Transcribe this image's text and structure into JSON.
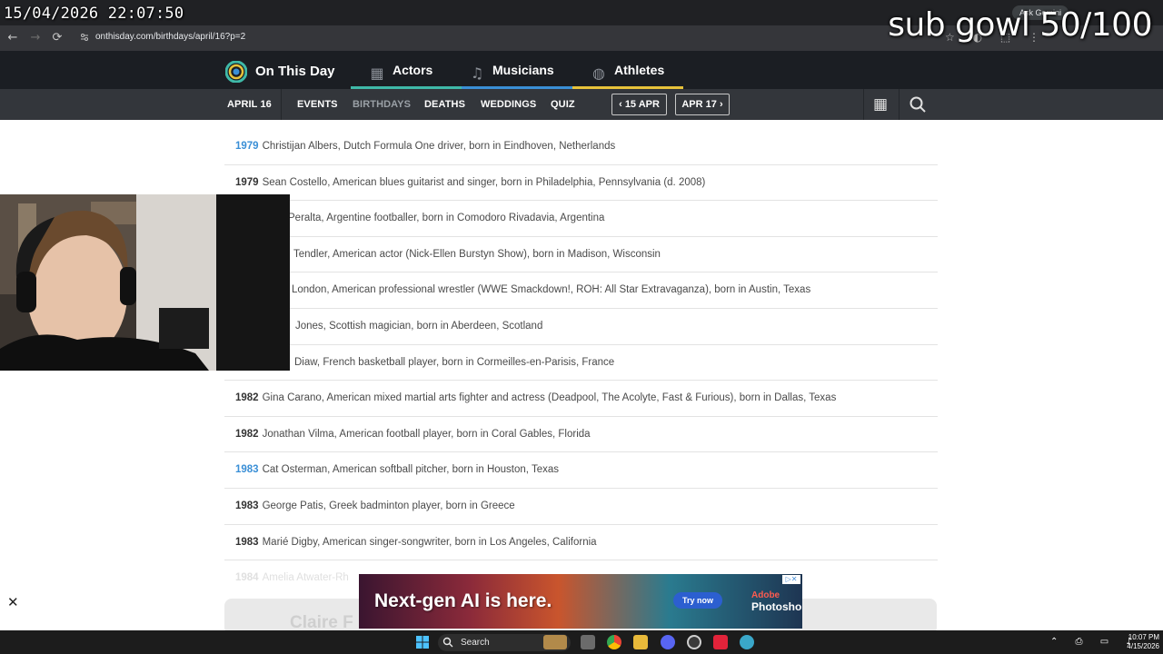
{
  "overlay": {
    "clock": "15/04/2026 22:07:50",
    "sub_goal": "sub gowl 50/100"
  },
  "browser": {
    "url": "onthisday.com/birthdays/april/16?p=2",
    "gemini": "Ask Gemini",
    "back": "←",
    "forward": "→",
    "reload": "⟳"
  },
  "site": {
    "name": "On This Day",
    "sections": [
      {
        "label": "Actors",
        "icon": "film-icon"
      },
      {
        "label": "Musicians",
        "icon": "music-note-icon"
      },
      {
        "label": "Athletes",
        "icon": "ball-icon"
      }
    ],
    "colors": {
      "actors": "#3fb9a8",
      "musicians": "#3a8fd6",
      "athletes": "#e7c23a"
    }
  },
  "subnav": {
    "date": "APRIL 16",
    "items": [
      "EVENTS",
      "BIRTHDAYS",
      "DEATHS",
      "WEDDINGS",
      "QUIZ"
    ],
    "active": "BIRTHDAYS",
    "prev": "15 APR",
    "next": "APR 17"
  },
  "births": [
    {
      "year": "1979",
      "text": "Christijan Albers, Dutch Formula One driver, born in Eindhoven, Netherlands",
      "link": true
    },
    {
      "year": "1979",
      "text": "Sean Costello, American blues guitarist and singer, born in Philadelphia, Pennsylvania (d. 2008)",
      "link": false
    },
    {
      "year": "",
      "text": "Peralta, Argentine footballer, born in Comodoro Rivadavia, Argentina",
      "link": false
    },
    {
      "year": "",
      "text": "Tendler, American actor (Nick-Ellen Burstyn Show), born in Madison, Wisconsin",
      "link": false
    },
    {
      "year": "",
      "text": "London, American professional wrestler (WWE Smackdown!, ROH: All Star Extravaganza), born in Austin, Texas",
      "link": false
    },
    {
      "year": "",
      "text": "Jones, Scottish magician, born in Aberdeen, Scotland",
      "link": false
    },
    {
      "year": "",
      "text": "Diaw, French basketball player, born in Cormeilles-en-Parisis, France",
      "link": false
    },
    {
      "year": "1982",
      "text": "Gina Carano, American mixed martial arts fighter and actress (Deadpool, The Acolyte, Fast & Furious), born in Dallas, Texas",
      "link": false
    },
    {
      "year": "1982",
      "text": "Jonathan Vilma, American football player, born in Coral Gables, Florida",
      "link": false
    },
    {
      "year": "1983",
      "text": "Cat Osterman, American softball pitcher, born in Houston, Texas",
      "link": true
    },
    {
      "year": "1983",
      "text": "George Patis, Greek badminton player, born in Greece",
      "link": false
    },
    {
      "year": "1983",
      "text": "Marié Digby, American singer-songwriter, born in Los Angeles, California",
      "link": false
    },
    {
      "year": "1984",
      "text": "Amelia Atwater-Rh",
      "link": false
    }
  ],
  "bottom_card": {
    "title": "Claire F"
  },
  "ad": {
    "headline": "Next-gen AI is here.",
    "cta": "Try now",
    "brand_top": "Adobe",
    "brand": "Photoshop"
  },
  "close_x": "✕",
  "taskbar": {
    "search": "Search",
    "time": "10:07 PM",
    "date": "4/15/2026"
  }
}
